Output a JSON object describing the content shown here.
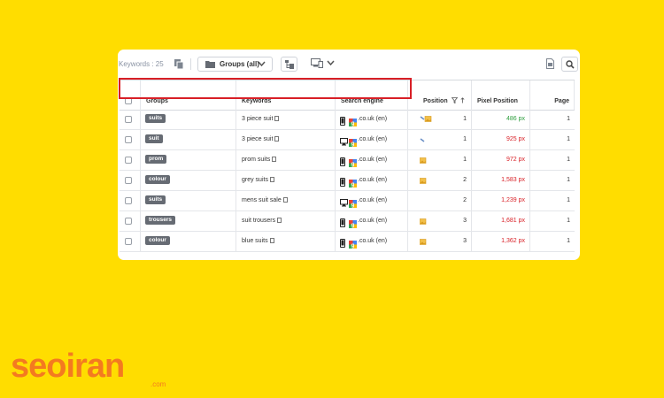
{
  "toolbar": {
    "keywords_label": "Keywords : 25",
    "group_select_label": "Groups (all)"
  },
  "columns": {
    "groups": "Groups",
    "keywords": "Keywords",
    "search_engine": "Search engine",
    "position": "Position",
    "pixel_position": "Pixel Position",
    "page": "Page"
  },
  "rows": [
    {
      "group": "suits",
      "keyword": "3 piece suit",
      "device": "mobile",
      "engine": ".co.uk (en)",
      "feature": "pin-image",
      "position": "1",
      "pixel": "486 px",
      "pixel_color": "#2e9e3e",
      "page": "1"
    },
    {
      "group": "suit",
      "keyword": "3 piece suit",
      "device": "desktop",
      "engine": ".co.uk (en)",
      "feature": "pin",
      "position": "1",
      "pixel": "925 px",
      "pixel_color": "#d81f26",
      "page": "1"
    },
    {
      "group": "prom",
      "keyword": "prom suits",
      "device": "mobile",
      "engine": ".co.uk (en)",
      "feature": "image",
      "position": "1",
      "pixel": "972 px",
      "pixel_color": "#d81f26",
      "page": "1"
    },
    {
      "group": "colour",
      "keyword": "grey suits",
      "device": "mobile",
      "engine": ".co.uk (en)",
      "feature": "image",
      "position": "2",
      "pixel": "1,583 px",
      "pixel_color": "#d81f26",
      "page": "1"
    },
    {
      "group": "suits",
      "keyword": "mens suit sale",
      "device": "desktop",
      "engine": ".co.uk (en)",
      "feature": "none",
      "position": "2",
      "pixel": "1,239 px",
      "pixel_color": "#d81f26",
      "page": "1"
    },
    {
      "group": "trousers",
      "keyword": "suit trousers",
      "device": "mobile",
      "engine": ".co.uk (en)",
      "feature": "image",
      "position": "3",
      "pixel": "1,681 px",
      "pixel_color": "#d81f26",
      "page": "1"
    },
    {
      "group": "colour",
      "keyword": "blue suits",
      "device": "mobile",
      "engine": ".co.uk (en)",
      "feature": "image",
      "position": "3",
      "pixel": "1,362 px",
      "pixel_color": "#d81f26",
      "page": "1"
    }
  ],
  "brand": {
    "name": "seoiran",
    "domain": ".com",
    "color": "#f47a20"
  },
  "background_color": "#FFDD00"
}
